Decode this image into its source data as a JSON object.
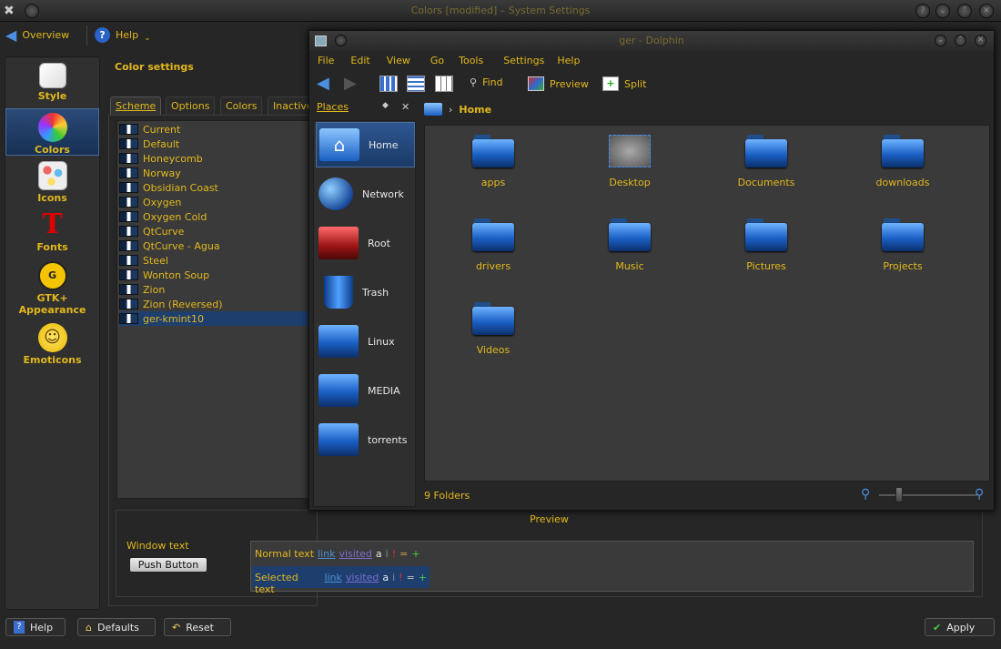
{
  "window": {
    "title": "Colors [modified] – System Settings"
  },
  "toolbar": {
    "overview": "Overview",
    "help": "Help"
  },
  "categories": [
    {
      "label": "Style",
      "icon": "style-icon"
    },
    {
      "label": "Colors",
      "icon": "colors-icon",
      "selected": true
    },
    {
      "label": "Icons",
      "icon": "icons-icon"
    },
    {
      "label": "Fonts",
      "icon": "fonts-icon"
    },
    {
      "label": "GTK+ Appearance",
      "icon": "gtk-icon"
    },
    {
      "label": "Emoticons",
      "icon": "emoticons-icon"
    }
  ],
  "color_settings": {
    "heading": "Color settings",
    "tabs": [
      "Scheme",
      "Options",
      "Colors",
      "Inactive"
    ],
    "schemes": [
      "Current",
      "Default",
      "Honeycomb",
      "Norway",
      "Obsidian Coast",
      "Oxygen",
      "Oxygen Cold",
      "QtCurve",
      "QtCurve - Agua",
      "Steel",
      "Wonton Soup",
      "Zion",
      "Zion (Reversed)",
      "ger-kmint10"
    ],
    "selected_scheme": "ger-kmint10"
  },
  "preview": {
    "title": "Preview",
    "window_text": "Window text",
    "push_button": "Push Button",
    "normal_text": "Normal text",
    "link": "link",
    "visited": "visited",
    "a": "a",
    "i": "i",
    "excl": "!",
    "eq": "=",
    "plus": "+",
    "selected_text": "Selected text"
  },
  "bottom": {
    "help": "Help",
    "defaults": "Defaults",
    "reset": "Reset",
    "apply": "Apply"
  },
  "dolphin": {
    "title": "ger - Dolphin",
    "menu": [
      "File",
      "Edit",
      "View",
      "Go",
      "Tools",
      "Settings",
      "Help"
    ],
    "toolbar": {
      "find": "Find",
      "preview": "Preview",
      "split": "Split"
    },
    "places_title": "Places",
    "places": [
      "Home",
      "Network",
      "Root",
      "Trash",
      "Linux",
      "MEDIA",
      "torrents"
    ],
    "breadcrumb": "Home",
    "folders": [
      "apps",
      "Desktop",
      "Documents",
      "downloads",
      "drivers",
      "Music",
      "Pictures",
      "Projects",
      "Videos"
    ],
    "status": "9 Folders"
  },
  "colors": {
    "accent": "#e2b81c",
    "selection": "#1e3f6e",
    "background": "#262626"
  }
}
